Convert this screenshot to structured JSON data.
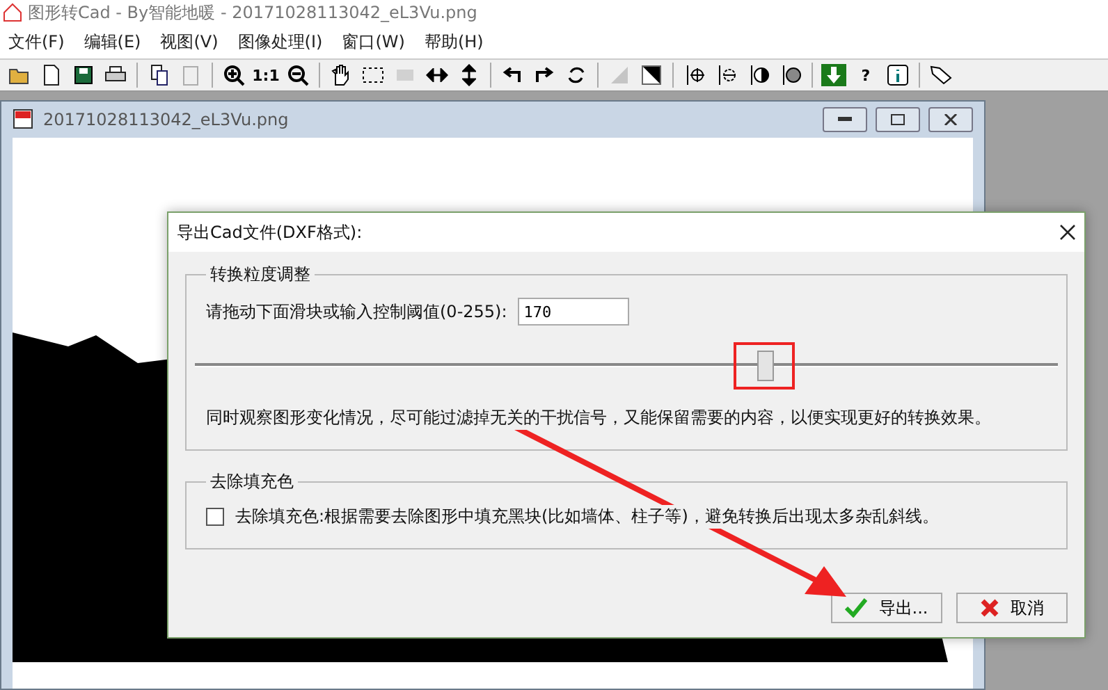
{
  "app": {
    "title": "图形转Cad - By智能地暖 - 20171028113042_eL3Vu.png"
  },
  "menu": [
    "文件(F)",
    "编辑(E)",
    "视图(V)",
    "图像处理(I)",
    "窗口(W)",
    "帮助(H)"
  ],
  "toolbar": [
    {
      "kind": "button",
      "disabled": false
    },
    {
      "kind": "button",
      "disabled": false
    },
    {
      "kind": "button",
      "disabled": false
    },
    {
      "kind": "button",
      "disabled": false
    },
    {
      "kind": "separator"
    },
    {
      "kind": "button",
      "disabled": false
    },
    {
      "kind": "button",
      "disabled": true
    },
    {
      "kind": "separator"
    },
    {
      "kind": "button",
      "disabled": false
    },
    {
      "kind": "text",
      "label": "1:1"
    },
    {
      "kind": "button",
      "disabled": false
    },
    {
      "kind": "separator"
    },
    {
      "kind": "button",
      "disabled": false
    },
    {
      "kind": "button",
      "disabled": false
    },
    {
      "kind": "button",
      "disabled": true
    },
    {
      "kind": "button",
      "disabled": false
    },
    {
      "kind": "button",
      "disabled": false
    },
    {
      "kind": "separator"
    },
    {
      "kind": "button",
      "disabled": false
    },
    {
      "kind": "button",
      "disabled": false
    },
    {
      "kind": "button",
      "disabled": false
    },
    {
      "kind": "separator"
    },
    {
      "kind": "button",
      "disabled": true
    },
    {
      "kind": "button",
      "disabled": false
    },
    {
      "kind": "separator"
    },
    {
      "kind": "button",
      "disabled": false
    },
    {
      "kind": "button",
      "disabled": false
    },
    {
      "kind": "button",
      "disabled": false
    },
    {
      "kind": "button",
      "disabled": false
    },
    {
      "kind": "separator"
    },
    {
      "kind": "button",
      "disabled": false
    },
    {
      "kind": "text",
      "label": "?"
    },
    {
      "kind": "button",
      "disabled": false
    },
    {
      "kind": "separator"
    },
    {
      "kind": "button",
      "disabled": false
    }
  ],
  "image_window": {
    "title": "20171028113042_eL3Vu.png"
  },
  "dialog": {
    "title": "导出Cad文件(DXF格式):",
    "group_1": {
      "legend": "转换粒度调整",
      "prompt": "请拖动下面滑块或输入控制阈值(0-255):",
      "value": "170",
      "slider": {
        "level": 0.66
      },
      "note": "同时观察图形变化情况，尽可能过滤掉无关的干扰信号，又能保留需要的内容，以便实现更好的转换效果。"
    },
    "group_2": {
      "legend": "去除填充色",
      "checkbox": {
        "label": "去除填充色:根据需要去除图形中填充黑块(比如墙体、柱子等)，避免转换后出现太多杂乱斜线。",
        "checked": false
      }
    },
    "buttons": [
      {
        "kind": "ok",
        "label": "导出..."
      },
      {
        "kind": "cancel",
        "label": "取消"
      }
    ]
  }
}
